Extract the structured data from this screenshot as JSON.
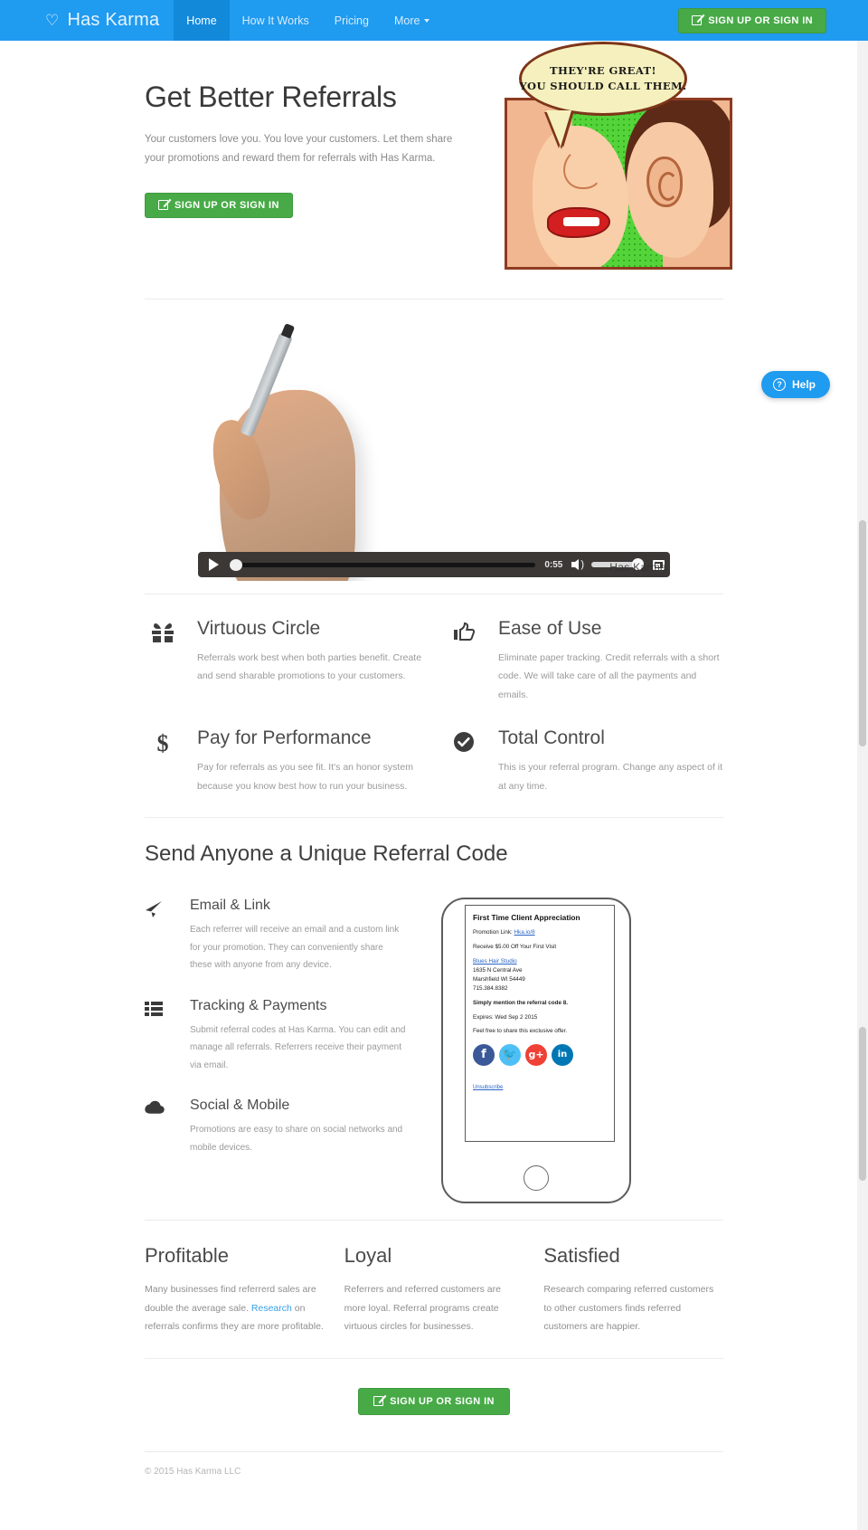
{
  "navbar": {
    "brand": "Has Karma",
    "brand_icon": "heart-outline-icon",
    "links": [
      {
        "label": "Home",
        "active": true
      },
      {
        "label": "How It Works",
        "active": false
      },
      {
        "label": "Pricing",
        "active": false
      },
      {
        "label": "More",
        "active": false,
        "has_caret": true
      }
    ],
    "cta_label": "SIGN UP OR SIGN IN",
    "bg_color": "#1f9bf0",
    "active_bg_color": "#1389da",
    "cta_color": "#47aa47"
  },
  "hero": {
    "title": "Get Better Referrals",
    "subtitle": "Your customers love you. You love your customers. Let them share your promotions and reward them for referrals with Has Karma.",
    "cta_label": "SIGN UP OR SIGN IN",
    "comic": {
      "bubble_line_1": "THEY'RE GREAT!",
      "bubble_line_2": "YOU SHOULD CALL THEM."
    }
  },
  "video": {
    "time": "0:55",
    "watermark": "Has Karma",
    "play_icon": "play-icon",
    "volume_icon": "speaker-icon",
    "fullscreen_icon": "fullscreen-icon"
  },
  "features": [
    {
      "icon": "gift-icon",
      "glyph": "\u0001",
      "title": "Virtuous Circle",
      "desc": "Referrals work best when both parties benefit. Create and send sharable promotions to your customers."
    },
    {
      "icon": "thumbs-up-icon",
      "glyph": "\u0002",
      "title": "Ease of Use",
      "desc": "Eliminate paper tracking. Credit referrals with a short code. We will take care of all the payments and emails."
    },
    {
      "icon": "dollar-sign-icon",
      "glyph": "$",
      "title": "Pay for Performance",
      "desc": "Pay for referrals as you see fit. It's an honor system because you know best how to run your business."
    },
    {
      "icon": "check-circle-icon",
      "glyph": "\u0003",
      "title": "Total Control",
      "desc": "This is your referral program. Change any aspect of it at any time."
    }
  ],
  "referral_section": {
    "title": "Send Anyone a Unique Referral Code",
    "items": [
      {
        "icon": "paper-plane-icon",
        "title": "Email & Link",
        "desc": "Each referrer will receive an email and a custom link for your promotion. They can conveniently share these with anyone from any device."
      },
      {
        "icon": "list-icon",
        "title": "Tracking & Payments",
        "desc": "Submit referral codes at Has Karma. You can edit and manage all referrals. Referrers receive their payment via email."
      },
      {
        "icon": "cloud-icon",
        "title": "Social & Mobile",
        "desc": "Promotions are easy to share on social networks and mobile devices."
      }
    ],
    "phone_email": {
      "title": "First Time Client Appreciation",
      "promotion_link_label": "Promotion Link:",
      "promotion_link": "Hka.io/8",
      "offer": "Receive $5.00 Off Your First Visit",
      "business_name": "Blues Hair Studio",
      "address_line_1": "1635 N Central Ave",
      "address_line_2": "Marshfield WI 54449",
      "phone": "715.384.8382",
      "code_line": "Simply mention the referral code 8.",
      "expires": "Expires: Wed Sep 2 2015",
      "share_line": "Feel free to share this exclusive offer.",
      "social": [
        {
          "name": "facebook-icon",
          "glyph": "f"
        },
        {
          "name": "twitter-icon",
          "glyph": "\u0004"
        },
        {
          "name": "google-plus-icon",
          "glyph": "g+"
        },
        {
          "name": "linkedin-icon",
          "glyph": "in"
        }
      ],
      "unsubscribe": "Unsubscribe"
    }
  },
  "benefits": [
    {
      "title": "Profitable",
      "desc_before": "Many businesses find referrerd sales are double the average sale. ",
      "link": "Research",
      "desc_after": " on referrals confirms they are more profitable."
    },
    {
      "title": "Loyal",
      "desc_before": "Referrers and referred customers are more loyal. Referral programs create virtuous circles for businesses.",
      "link": "",
      "desc_after": ""
    },
    {
      "title": "Satisfied",
      "desc_before": "Research comparing referred customers to other customers finds referred customers are happier.",
      "link": "",
      "desc_after": ""
    }
  ],
  "bottom_cta": {
    "label": "SIGN UP OR SIGN IN"
  },
  "footer": {
    "copyright": "© 2015 Has Karma LLC"
  },
  "help_widget": {
    "label": "Help",
    "icon": "question-circle-icon"
  }
}
